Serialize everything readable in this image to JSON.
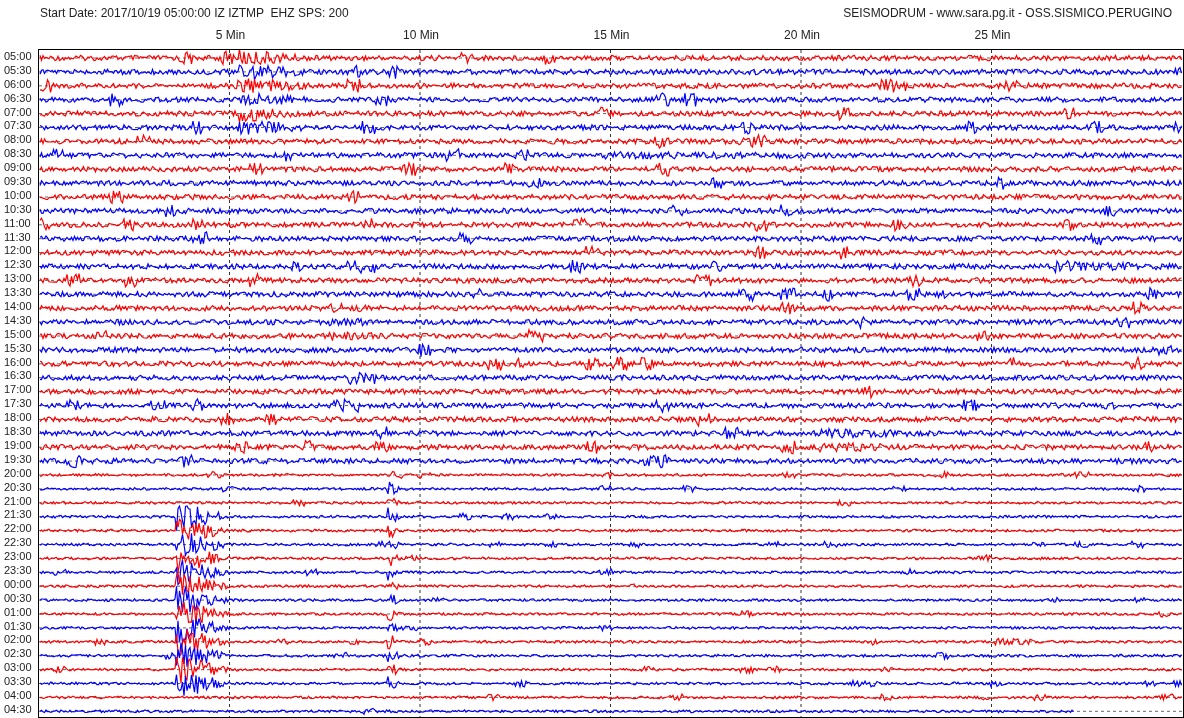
{
  "header": {
    "info": "Start Date: 2017/10/19 05:00:00 IZ IZTMP  EHZ SPS: 200",
    "title": "SEISMODRUM - www.sara.pg.it - OSS.SISMICO.PERUGINO"
  },
  "x_axis_labels": [
    "5 Min",
    "10 Min",
    "15 Min",
    "20 Min",
    "25 Min"
  ],
  "rows": [
    {
      "label": "05:00",
      "color": "#ff0000"
    },
    {
      "label": "05:30",
      "color": "#0000ff"
    },
    {
      "label": "06:00",
      "color": "#ff0000"
    },
    {
      "label": "06:30",
      "color": "#0000ff"
    },
    {
      "label": "07:00",
      "color": "#ff0000"
    },
    {
      "label": "07:30",
      "color": "#0000ff"
    },
    {
      "label": "08:00",
      "color": "#ff0000"
    },
    {
      "label": "08:30",
      "color": "#0000ff"
    },
    {
      "label": "09:00",
      "color": "#ff0000"
    },
    {
      "label": "09:30",
      "color": "#0000ff"
    },
    {
      "label": "10:00",
      "color": "#ff0000"
    },
    {
      "label": "10:30",
      "color": "#0000ff"
    },
    {
      "label": "11:00",
      "color": "#ff0000"
    },
    {
      "label": "11:30",
      "color": "#0000ff"
    },
    {
      "label": "12:00",
      "color": "#ff0000"
    },
    {
      "label": "12:30",
      "color": "#0000ff"
    },
    {
      "label": "13:00",
      "color": "#ff0000"
    },
    {
      "label": "13:30",
      "color": "#0000ff"
    },
    {
      "label": "14:00",
      "color": "#ff0000"
    },
    {
      "label": "14:30",
      "color": "#0000ff"
    },
    {
      "label": "15:00",
      "color": "#ff0000"
    },
    {
      "label": "15:30",
      "color": "#0000ff"
    },
    {
      "label": "16:00",
      "color": "#ff0000"
    },
    {
      "label": "16:30",
      "color": "#0000ff"
    },
    {
      "label": "17:00",
      "color": "#ff0000"
    },
    {
      "label": "17:30",
      "color": "#0000ff"
    },
    {
      "label": "18:00",
      "color": "#ff0000"
    },
    {
      "label": "18:30",
      "color": "#0000ff"
    },
    {
      "label": "19:00",
      "color": "#ff0000"
    },
    {
      "label": "19:30",
      "color": "#0000ff"
    },
    {
      "label": "20:00",
      "color": "#ff0000"
    },
    {
      "label": "20:30",
      "color": "#0000ff"
    },
    {
      "label": "21:00",
      "color": "#ff0000"
    },
    {
      "label": "21:30",
      "color": "#0000ff"
    },
    {
      "label": "22:00",
      "color": "#ff0000"
    },
    {
      "label": "22:30",
      "color": "#0000ff"
    },
    {
      "label": "23:00",
      "color": "#ff0000"
    },
    {
      "label": "23:30",
      "color": "#0000ff"
    },
    {
      "label": "00:00",
      "color": "#ff0000"
    },
    {
      "label": "00:30",
      "color": "#0000ff"
    },
    {
      "label": "01:00",
      "color": "#ff0000"
    },
    {
      "label": "01:30",
      "color": "#0000ff"
    },
    {
      "label": "02:00",
      "color": "#ff0000"
    },
    {
      "label": "02:30",
      "color": "#0000ff"
    },
    {
      "label": "03:00",
      "color": "#ff0000"
    },
    {
      "label": "03:30",
      "color": "#0000ff"
    },
    {
      "label": "04:00",
      "color": "#ff0000"
    },
    {
      "label": "04:30",
      "color": "#0000ff"
    }
  ]
}
